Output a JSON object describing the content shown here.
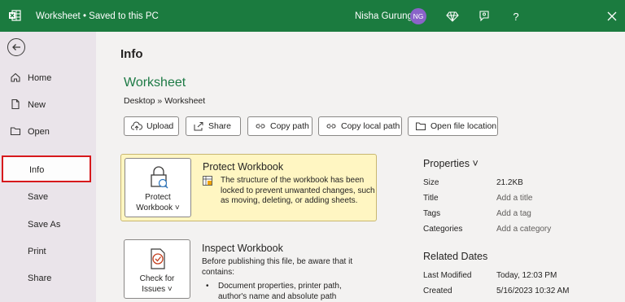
{
  "titlebar": {
    "title": "Worksheet • Saved to this PC",
    "user_name": "Nisha Gurung",
    "avatar_initials": "NG",
    "brand_color": "#1b7b3f",
    "icons": [
      "excel-app-icon",
      "diamond-icon",
      "feedback-icon",
      "help-icon",
      "close-icon"
    ]
  },
  "sidebar": {
    "items": [
      {
        "label": "Home",
        "icon": "home-icon"
      },
      {
        "label": "New",
        "icon": "new-file-icon"
      },
      {
        "label": "Open",
        "icon": "folder-icon"
      },
      {
        "label": "Info"
      },
      {
        "label": "Save"
      },
      {
        "label": "Save As"
      },
      {
        "label": "Print"
      },
      {
        "label": "Share"
      }
    ],
    "selected": "Info",
    "highlight_color": "#d7191c"
  },
  "main": {
    "heading": "Info",
    "doc_title": "Worksheet",
    "breadcrumb": "Desktop » Worksheet",
    "actions": [
      {
        "label": "Upload",
        "icon": "upload-icon"
      },
      {
        "label": "Share",
        "icon": "share-icon"
      },
      {
        "label": "Copy path",
        "icon": "link-icon"
      },
      {
        "label": "Copy local path",
        "icon": "link-icon"
      },
      {
        "label": "Open file location",
        "icon": "folder-icon"
      }
    ],
    "protect": {
      "button_line1": "Protect",
      "button_line2": "Workbook ˅",
      "title": "Protect Workbook",
      "description": "The structure of the workbook has been locked to prevent unwanted changes, such as moving, deleting, or adding sheets."
    },
    "inspect": {
      "button_line1": "Check for",
      "button_line2": "Issues ˅",
      "title": "Inspect Workbook",
      "description": "Before publishing this file, be aware that it contains:",
      "bullet": "Document properties, printer path, author's name and absolute path"
    }
  },
  "properties": {
    "heading": "Properties ˅",
    "rows": [
      {
        "key": "Size",
        "value": "21.2KB"
      },
      {
        "key": "Title",
        "value": "Add a title"
      },
      {
        "key": "Tags",
        "value": "Add a tag"
      },
      {
        "key": "Categories",
        "value": "Add a category"
      }
    ]
  },
  "related_dates": {
    "heading": "Related Dates",
    "rows": [
      {
        "key": "Last Modified",
        "value": "Today, 12:03 PM"
      },
      {
        "key": "Created",
        "value": "5/16/2023 10:32 AM"
      }
    ]
  }
}
